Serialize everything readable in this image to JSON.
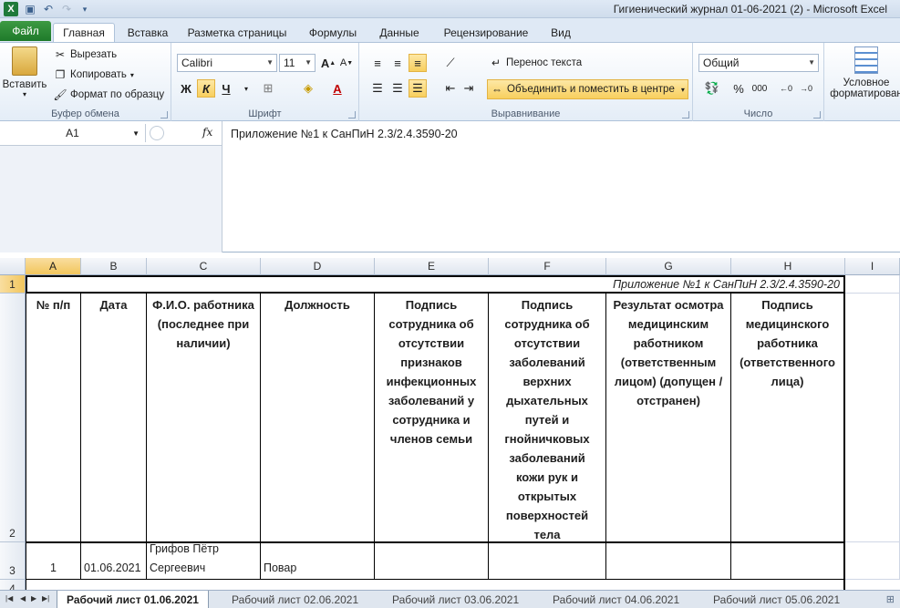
{
  "window": {
    "title": "Гигиенический журнал 01-06-2021 (2)  -  Microsoft Excel",
    "app_icon": "X"
  },
  "tabs": {
    "file": "Файл",
    "items": [
      "Главная",
      "Вставка",
      "Разметка страницы",
      "Формулы",
      "Данные",
      "Рецензирование",
      "Вид"
    ]
  },
  "ribbon": {
    "clipboard": {
      "label": "Буфер обмена",
      "paste": "Вставить",
      "cut": "Вырезать",
      "copy": "Копировать",
      "format_painter": "Формат по образцу"
    },
    "font": {
      "label": "Шрифт",
      "font_name": "Calibri",
      "font_size": "11",
      "bold": "Ж",
      "italic": "К",
      "underline": "Ч"
    },
    "alignment": {
      "label": "Выравнивание",
      "wrap": "Перенос текста",
      "merge": "Объединить и поместить в центре"
    },
    "number": {
      "label": "Число",
      "format": "Общий",
      "percent": "%",
      "thousands": "000"
    },
    "styles": {
      "conditional_line1": "Условное",
      "conditional_line2": "форматирован"
    }
  },
  "formula_bar": {
    "name_box": "A1",
    "fx": "fx",
    "content": "Приложение №1 к СанПиН 2.3/2.4.3590-20"
  },
  "sheet": {
    "columns": [
      "A",
      "B",
      "C",
      "D",
      "E",
      "F",
      "G",
      "H",
      "I"
    ],
    "rows": [
      "1",
      "2",
      "3",
      "4"
    ],
    "a1_text": "Приложение №1 к СанПиН 2.3/2.4.3590-20",
    "headers": [
      "№ п/п",
      "Дата",
      "Ф.И.О. работника (последнее при наличии)",
      "Должность",
      "Подпись сотрудника об отсутствии признаков инфекционных заболеваний у сотрудника и членов семьи",
      "Подпись сотрудника об отсутствии заболеваний верхних дыхательных путей и гнойничковых заболеваний кожи рук и открытых поверхностей тела",
      "Результат осмотра медицинским работником (ответственным лицом) (допущен / отстранен)",
      "Подпись медицинского работника (ответственного лица)"
    ],
    "row3": {
      "num": "1",
      "date": "01.06.2021",
      "fio": "Грифов Пётр Сергеевич",
      "position": "Повар"
    }
  },
  "sheet_tabs": [
    "Рабочий лист 01.06.2021",
    "Рабочий лист 02.06.2021",
    "Рабочий лист 03.06.2021",
    "Рабочий лист 04.06.2021",
    "Рабочий лист 05.06.2021"
  ]
}
